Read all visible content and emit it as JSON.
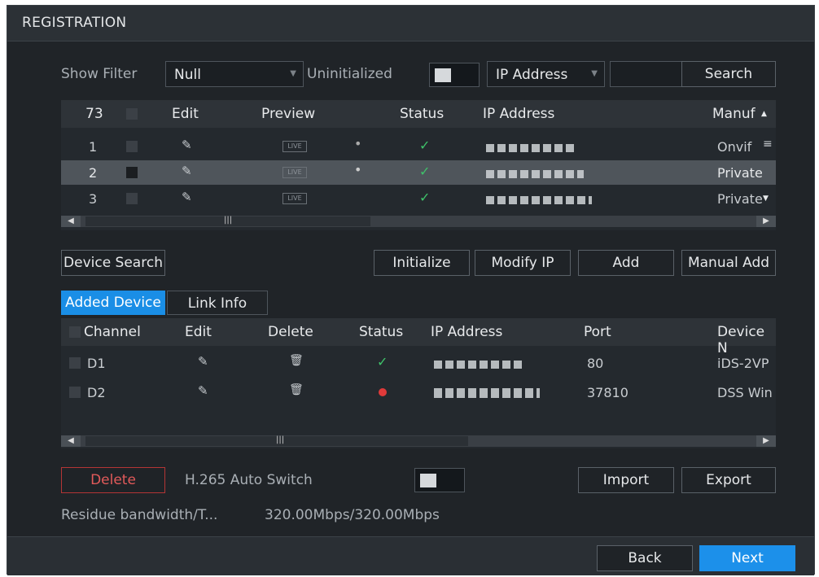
{
  "window": {
    "title": "REGISTRATION"
  },
  "filter": {
    "show_filter_label": "Show Filter",
    "show_filter_value": "Null",
    "uninitialized_label": "Uninitialized",
    "search_type_value": "IP Address",
    "search_input_value": "",
    "search_button": "Search"
  },
  "search_table": {
    "headers": {
      "count": "73",
      "edit": "Edit",
      "preview": "Preview",
      "status": "Status",
      "ip": "IP Address",
      "manuf": "Manuf"
    },
    "rows": [
      {
        "num": "1",
        "manuf": "Onvif",
        "preview": "LIVE",
        "selected": false
      },
      {
        "num": "2",
        "manuf": "Private",
        "preview": "LIVE",
        "selected": true
      },
      {
        "num": "3",
        "manuf": "Private",
        "preview": "LIVE",
        "selected": false
      }
    ]
  },
  "actions": {
    "device_search": "Device Search",
    "initialize": "Initialize",
    "modify_ip": "Modify IP",
    "add": "Add",
    "manual_add": "Manual Add"
  },
  "tabs": {
    "added_device": "Added Device",
    "link_info": "Link Info"
  },
  "added_table": {
    "headers": {
      "channel": "Channel",
      "edit": "Edit",
      "delete": "Delete",
      "status": "Status",
      "ip": "IP Address",
      "port": "Port",
      "device": "Device N"
    },
    "rows": [
      {
        "channel": "D1",
        "port": "80",
        "device": "iDS-2VP",
        "status": "online"
      },
      {
        "channel": "D2",
        "port": "37810",
        "device": "DSS Win",
        "status": "offline"
      }
    ]
  },
  "bottom": {
    "delete": "Delete",
    "h265_label": "H.265 Auto Switch",
    "import": "Import",
    "export": "Export",
    "bandwidth_label": "Residue bandwidth/T...",
    "bandwidth_value": "320.00Mbps/320.00Mbps"
  },
  "footer": {
    "back": "Back",
    "next": "Next"
  },
  "icons": {
    "pencil": "pencil-icon",
    "trash": "trash-icon",
    "check": "check-icon",
    "dot": "red-dot-icon"
  },
  "colors": {
    "accent": "#1c90ea",
    "online": "#3fc26a",
    "offline": "#e03a3a",
    "delete_border": "#b43535"
  }
}
